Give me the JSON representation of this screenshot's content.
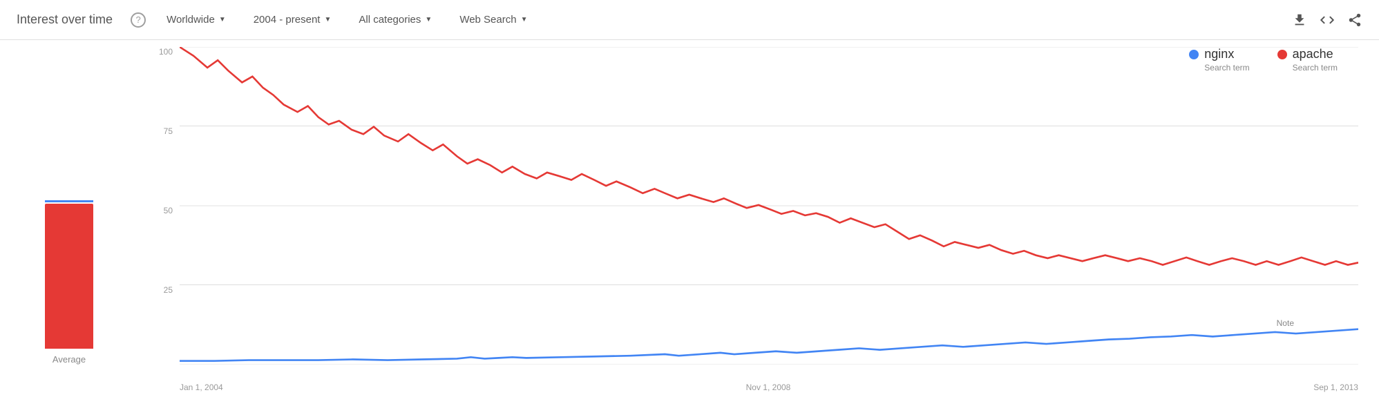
{
  "header": {
    "title": "Interest over time",
    "help_label": "?",
    "location": {
      "label": "Worldwide",
      "arrow": "▼"
    },
    "time_range": {
      "label": "2004 - present",
      "arrow": "▼"
    },
    "categories": {
      "label": "All categories",
      "arrow": "▼"
    },
    "search_type": {
      "label": "Web Search",
      "arrow": "▼"
    }
  },
  "legend": {
    "items": [
      {
        "name": "nginx",
        "sub": "Search term",
        "color": "#4285F4"
      },
      {
        "name": "apache",
        "sub": "Search term",
        "color": "#e53935"
      }
    ]
  },
  "chart": {
    "y_labels": [
      "100",
      "75",
      "50",
      "25",
      ""
    ],
    "x_labels": [
      "Jan 1, 2004",
      "Nov 1, 2008",
      "Sep 1, 2013"
    ],
    "note_label": "Note",
    "avg_label": "Average"
  }
}
